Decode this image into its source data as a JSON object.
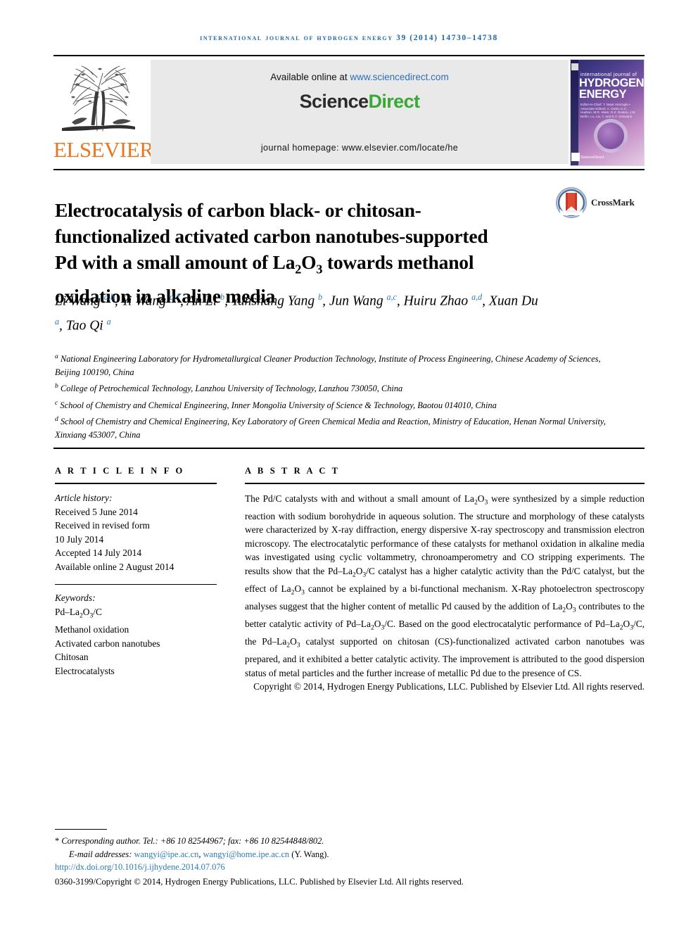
{
  "running_head": "International Journal of Hydrogen Energy 39 (2014) 14730–14738",
  "masthead": {
    "publisher_name": "ELSEVIER",
    "publisher_logo_icon": "elsevier-tree-logo",
    "available_prefix": "Available online at ",
    "available_url": "www.sciencedirect.com",
    "brand_part1": "Science",
    "brand_part2": "Direct",
    "journal_homepage": "journal homepage: www.elsevier.com/locate/he",
    "cover": {
      "line_small": "international journal of",
      "line_big1": "HYDROGEN",
      "line_big2": "ENERGY",
      "editor_lines": "Editor-in-Chief: T. Nejat Veziroglu  •  Associate Editors: A. Dicks, D.C. Hudson, M.R. Islam, R.Z. Rosten, J.M. Berlin, Lu, Liu, T. and D.Y. Goswami",
      "footer": "ScienceDirect"
    }
  },
  "article": {
    "title_html": "Electrocatalysis of carbon black- or chitosan-functionalized activated carbon nanotubes-supported Pd with a small amount of La<sub>2</sub>O<sub>3</sub> towards methanol oxidation in alkaline media",
    "crossmark_label": "CrossMark",
    "authors_html": "Li Wang <sup>a,b</sup>, Yi Wang <sup>a,*</sup>, An Li <sup>b</sup>, Yunshang Yang <sup>b</sup>, Jun Wang <sup>a,c</sup>, Huiru Zhao <sup>a,d</sup>, Xuan Du <sup>a</sup>, Tao Qi <sup>a</sup>",
    "affiliations": [
      {
        "marker": "a",
        "text": "National Engineering Laboratory for Hydrometallurgical Cleaner Production Technology, Institute of Process Engineering, Chinese Academy of Sciences, Beijing 100190, China"
      },
      {
        "marker": "b",
        "text": "College of Petrochemical Technology, Lanzhou University of Technology, Lanzhou 730050, China"
      },
      {
        "marker": "c",
        "text": "School of Chemistry and Chemical Engineering, Inner Mongolia University of Science & Technology, Baotou 014010, China"
      },
      {
        "marker": "d",
        "text": "School of Chemistry and Chemical Engineering, Key Laboratory of Green Chemical Media and Reaction, Ministry of Education, Henan Normal University, Xinxiang 453007, China"
      }
    ]
  },
  "article_info": {
    "heading": "A R T I C L E   I N F O",
    "history_label": "Article history:",
    "history": [
      "Received 5 June 2014",
      "Received in revised form",
      "10 July 2014",
      "Accepted 14 July 2014",
      "Available online 2 August 2014"
    ],
    "keywords_label": "Keywords:",
    "keywords_html": [
      "Pd–La<sub>2</sub>O<sub>3</sub>/C",
      "Methanol oxidation",
      "Activated carbon nanotubes",
      "Chitosan",
      "Electrocatalysts"
    ]
  },
  "abstract": {
    "heading": "A B S T R A C T",
    "body_html": "The Pd/C catalysts with and without a small amount of La<sub>2</sub>O<sub>3</sub> were synthesized by a simple reduction reaction with sodium borohydride in aqueous solution. The structure and morphology of these catalysts were characterized by X-ray diffraction, energy dispersive X-ray spectroscopy and transmission electron microscopy. The electrocatalytic performance of these catalysts for methanol oxidation in alkaline media was investigated using cyclic voltammetry, chronoamperometry and CO stripping experiments. The results show that the Pd–La<sub>2</sub>O<sub>3</sub>/C catalyst has a higher catalytic activity than the Pd/C catalyst, but the effect of La<sub>2</sub>O<sub>3</sub> cannot be explained by a bi-functional mechanism. X-Ray photoelectron spectroscopy analyses suggest that the higher content of metallic Pd caused by the addition of La<sub>2</sub>O<sub>3</sub> contributes to the better catalytic activity of Pd–La<sub>2</sub>O<sub>3</sub>/C. Based on the good electrocatalytic performance of Pd–La<sub>2</sub>O<sub>3</sub>/C, the Pd–La<sub>2</sub>O<sub>3</sub> catalyst supported on chitosan (CS)-functionalized activated carbon nanotubes was prepared, and it exhibited a better catalytic activity. The improvement is attributed to the good dispersion status of metal particles and the further increase of metallic Pd due to the presence of CS.",
    "copyright": "Copyright © 2014, Hydrogen Energy Publications, LLC. Published by Elsevier Ltd. All rights reserved."
  },
  "footnotes": {
    "corresponding": "Corresponding author. Tel.: +86 10 82544967; fax: +86 10 82544848/802.",
    "email_label": "E-mail addresses: ",
    "email1": "wangyi@ipe.ac.cn",
    "email_sep": ", ",
    "email2": "wangyi@home.ipe.ac.cn",
    "email_suffix": " (Y. Wang).",
    "doi": "http://dx.doi.org/10.1016/j.ijhydene.2014.07.076",
    "issn_line": "0360-3199/Copyright © 2014, Hydrogen Energy Publications, LLC. Published by Elsevier Ltd. All rights reserved."
  },
  "colors": {
    "journal_blue": "#1c66a8",
    "link_blue": "#2e7bb5",
    "elsevier_orange": "#e87722",
    "sciencedirect_green": "#39a935"
  }
}
